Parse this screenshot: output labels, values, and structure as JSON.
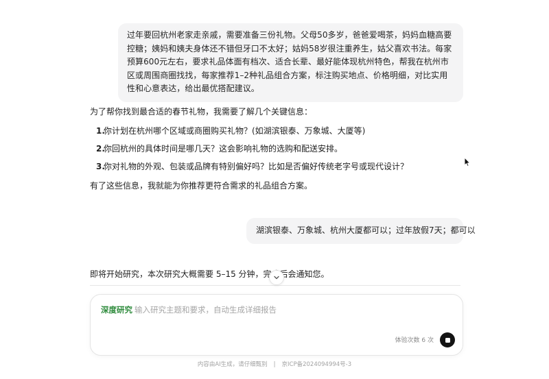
{
  "messages": {
    "user_1": "过年要回杭州老家走亲戚，需要准备三份礼物。父母50多岁，爸爸爱喝茶，妈妈血糖高要控糖；姨妈和姨夫身体还不错但牙口不太好；姑妈58岁很注重养生，姑父喜欢书法。每家预算600元左右，要求礼品体面有档次、适合长辈、最好能体现杭州特色，帮我在杭州市区或周围商圈找找，每家推荐1–2种礼品组合方案，标注购买地点、价格明细，对比实用性和心意表达，给出最优搭配建议。",
    "assistant_intro": "为了帮你找到最合适的春节礼物，我需要了解几个关键信息：",
    "assistant_questions": [
      {
        "num": "1.",
        "text": "你计划在杭州哪个区域或商圈购买礼物？(如湖滨银泰、万象城、大厦等)"
      },
      {
        "num": "2.",
        "text": "你回杭州的具体时间是哪几天？这会影响礼物的选购和配送安排。"
      },
      {
        "num": "3.",
        "text": "你对礼物的外观、包装或品牌有特别偏好吗？比如是否偏好传统老字号或现代设计？"
      }
    ],
    "assistant_outro": "有了这些信息，我就能为你推荐更符合需求的礼品组合方案。",
    "user_2": "湖滨银泰、万象城、杭州大厦都可以；过年放假7天；都可以",
    "research_note": "即将开始研究，本次研究大概需要 5–15 分钟，完成后会通知您。"
  },
  "composer": {
    "mode_label": "深度研究",
    "placeholder": "输入研究主题和要求，自动生成详细报告",
    "value": "",
    "usage_text": "体验次数 6 次"
  },
  "footer": {
    "notice": "内容由AI生成，请仔细甄别",
    "separator": "|",
    "icp": "京ICP备2024094994号-3"
  },
  "icons": {
    "scroll": "chevron-down-icon",
    "stop": "stop-icon",
    "pointer": "mouse-cursor-icon"
  },
  "colors": {
    "accent_green": "#2e8b3c",
    "bubble_bg": "#f4f4f5",
    "stop_button": "#141414"
  }
}
